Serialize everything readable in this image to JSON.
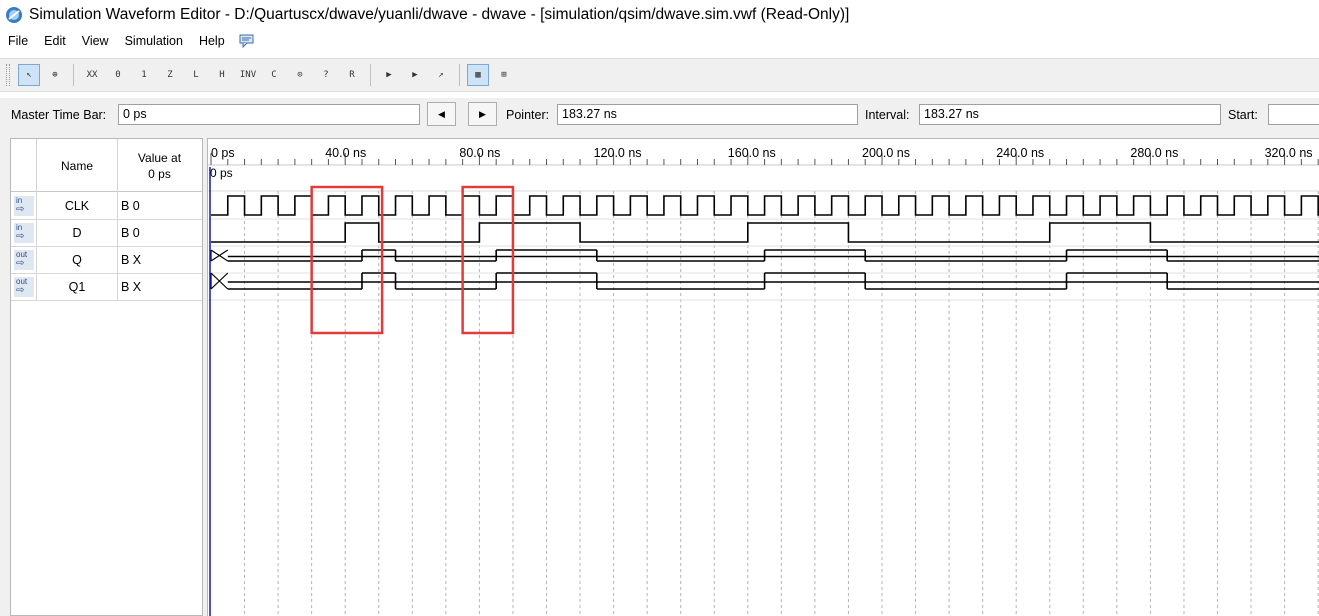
{
  "window": {
    "title": "Simulation Waveform Editor - D:/Quartuscx/dwave/yuanli/dwave - dwave - [simulation/qsim/dwave.sim.vwf (Read-Only)]"
  },
  "menu": {
    "items": [
      "File",
      "Edit",
      "View",
      "Simulation",
      "Help"
    ],
    "extra_icon": "comment-icon"
  },
  "toolbar": {
    "buttons": [
      {
        "name": "selection-tool",
        "glyph": "↖",
        "active": true
      },
      {
        "name": "zoom-tool",
        "glyph": "⊕",
        "active": false
      },
      {
        "name": "uninitialized",
        "glyph": "XX",
        "active": false
      },
      {
        "name": "forcing-low",
        "glyph": "0",
        "active": false
      },
      {
        "name": "forcing-high",
        "glyph": "1",
        "active": false
      },
      {
        "name": "high-impedance",
        "glyph": "Z",
        "active": false
      },
      {
        "name": "weak-low",
        "glyph": "L",
        "active": false
      },
      {
        "name": "weak-high",
        "glyph": "H",
        "active": false
      },
      {
        "name": "invert",
        "glyph": "INV",
        "active": false
      },
      {
        "name": "count-value",
        "glyph": "C",
        "active": false
      },
      {
        "name": "clock",
        "glyph": "⊙",
        "active": false
      },
      {
        "name": "arbitrary-value",
        "glyph": "?",
        "active": false
      },
      {
        "name": "random-value",
        "glyph": "R",
        "active": false
      },
      {
        "name": "run-functional-simulation",
        "glyph": "▶",
        "active": false
      },
      {
        "name": "run-timing-simulation",
        "glyph": "▶",
        "active": false
      },
      {
        "name": "generate-netlist",
        "glyph": "↗",
        "active": false
      },
      {
        "name": "waveform-compare",
        "glyph": "▦",
        "active": true
      },
      {
        "name": "grid-snap",
        "glyph": "⊞",
        "active": false
      }
    ]
  },
  "timebar": {
    "master_label": "Master Time Bar:",
    "master_value": "0 ps",
    "prev_icon": "triangle-left-icon",
    "next_icon": "triangle-right-icon",
    "pointer_label": "Pointer:",
    "pointer_value": "183.27 ns",
    "interval_label": "Interval:",
    "interval_value": "183.27 ns",
    "start_label": "Start:",
    "start_value": ""
  },
  "signals": {
    "header_name": "Name",
    "header_value_line1": "Value at",
    "header_value_line2": "0 ps",
    "rows": [
      {
        "dir": "in",
        "name": "CLK",
        "value": "B 0"
      },
      {
        "dir": "in",
        "name": "D",
        "value": "B 0"
      },
      {
        "dir": "out",
        "name": "Q",
        "value": "B X"
      },
      {
        "dir": "out",
        "name": "Q1",
        "value": "B X"
      }
    ]
  },
  "waveform": {
    "time_marker_label": "0 ps",
    "ruler_labels": [
      "0 ps",
      "40.0 ns",
      "80.0 ns",
      "120.0 ns",
      "160.0 ns",
      "200.0 ns",
      "240.0 ns",
      "280.0 ns",
      "320.0 ns"
    ],
    "ruler_values_ns": [
      0,
      40,
      80,
      120,
      160,
      200,
      240,
      280,
      320
    ],
    "time_range_ns": [
      0,
      331
    ],
    "clock_period_ns": 10,
    "clock_initial": 0,
    "d_transitions_ns": [
      40,
      50,
      80,
      110,
      160,
      190,
      250,
      280
    ],
    "q_unknown_until_ns": 5,
    "q_transitions_ns": [
      45,
      55,
      85,
      115,
      165,
      195,
      255,
      285
    ],
    "annotation_boxes_ns": [
      [
        30,
        51
      ],
      [
        75,
        90
      ]
    ],
    "annotation_color": "#e03c3c",
    "marker_color": "#1a1aa8"
  }
}
